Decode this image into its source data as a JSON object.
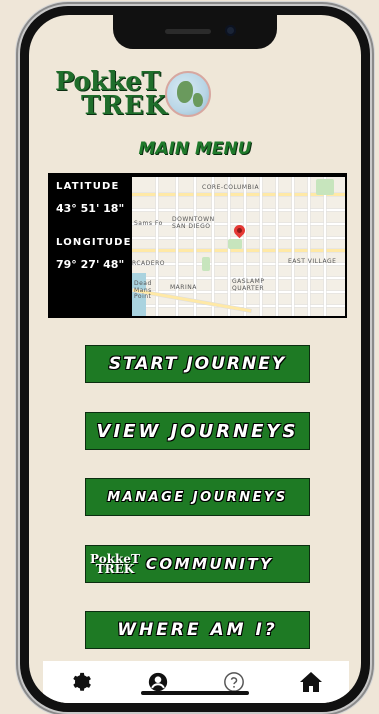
{
  "app": {
    "logo_line1": "PokkeT",
    "logo_line2": "TREK"
  },
  "header": {
    "title": "MAIN MENU"
  },
  "location": {
    "latitude_label": "LATITUDE",
    "latitude_value": "43° 51' 18\"",
    "longitude_label": "LONGITUDE",
    "longitude_value": "79° 27' 48\""
  },
  "map": {
    "labels": [
      "CORE-COLUMBIA",
      "DOWNTOWN SAN DIEGO",
      "EAST VILLAGE",
      "GASLAMP QUARTER",
      "MARINA",
      "Dead Mans Point",
      "RCADERO",
      "Sams Fo"
    ]
  },
  "menu": {
    "start_journey": "START JOURNEY",
    "view_journeys": "VIEW JOURNEYS",
    "manage_journeys": "MANAGE JOURNEYS",
    "community": "COMMUNITY",
    "where_am_i": "WHERE AM I?"
  },
  "nav": {
    "items": [
      "gear-icon",
      "profile-icon",
      "help-icon",
      "home-icon"
    ]
  },
  "colors": {
    "brand_green": "#1e7a24",
    "background": "#efe7d8"
  }
}
